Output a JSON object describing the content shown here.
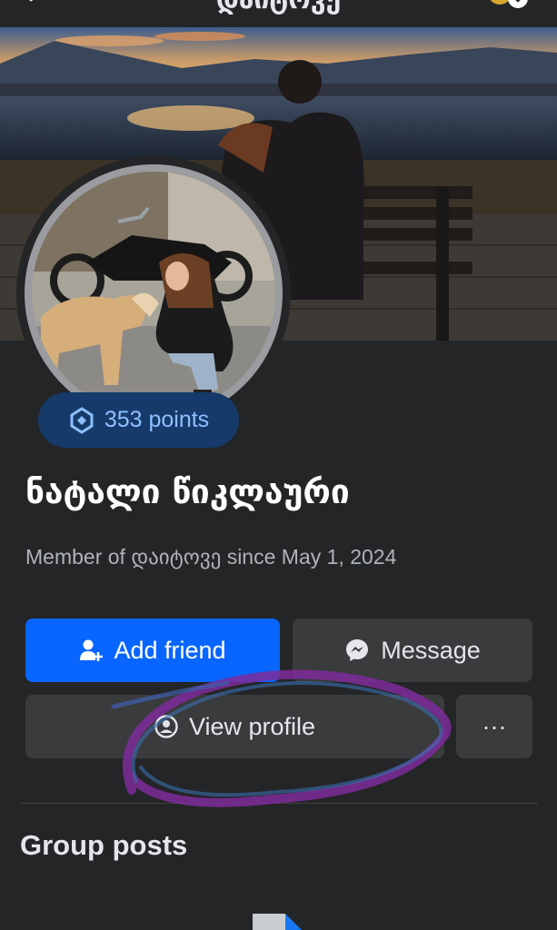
{
  "header": {
    "title": "დაიტოვე",
    "back_icon": "arrow-left-icon",
    "account_icon": "account-switcher-icon"
  },
  "profile": {
    "points_label": "353 points",
    "points_icon": "points-badge-icon",
    "name": "ნატალი წიკლაური",
    "member_line": "Member of დაიტოვე since May 1, 2024"
  },
  "actions": {
    "add_friend": "Add friend",
    "message": "Message",
    "view_profile": "View profile",
    "more": "···"
  },
  "sections": {
    "group_posts": "Group posts"
  },
  "colors": {
    "background": "#242526",
    "primary_button": "#0866ff",
    "secondary_button": "#3a3b3c",
    "points_badge": "#163a6a",
    "points_text": "#8fc0ff",
    "annotation": "#8b2fa8"
  }
}
